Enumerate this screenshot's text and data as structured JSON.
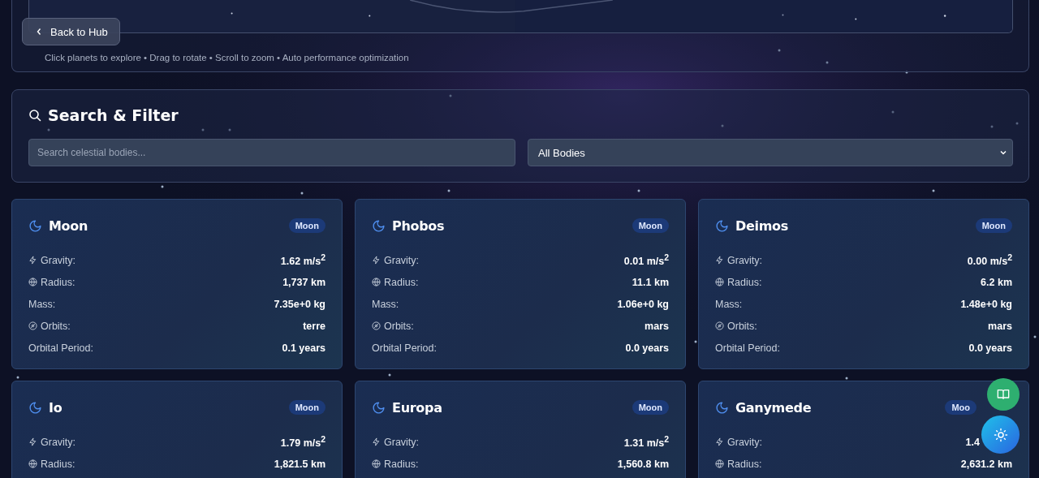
{
  "back_button": {
    "label": "Back to Hub"
  },
  "viewer": {
    "kind": "picture",
    "hint": "Click planets to explore • Drag to rotate • Scroll to zoom • Auto performance optimization"
  },
  "search_filter": {
    "title": "Search & Filter",
    "search": {
      "placeholder": "Search celestial bodies..."
    },
    "filter": {
      "value": "All Bodies"
    }
  },
  "cards": [
    {
      "name": "Moon",
      "badge": "Moon",
      "stats": [
        {
          "kind": "gravity",
          "label": "Gravity:",
          "value": "1.62 m/s$^{2}$"
        },
        {
          "kind": "radius",
          "label": "Radius:",
          "value": "1,737 km"
        },
        {
          "kind": "plain",
          "label": "Mass:",
          "value": "7.35e+0 kg"
        },
        {
          "kind": "orbit",
          "label": "Orbits:",
          "value": "terre"
        },
        {
          "kind": "plain",
          "label": "Orbital Period:",
          "value": "0.1 years"
        }
      ]
    },
    {
      "name": "Phobos",
      "badge": "Moon",
      "stats": [
        {
          "kind": "gravity",
          "label": "Gravity:",
          "value": "0.01 m/s$^{2}$"
        },
        {
          "kind": "radius",
          "label": "Radius:",
          "value": "11.1 km"
        },
        {
          "kind": "plain",
          "label": "Mass:",
          "value": "1.06e+0 kg"
        },
        {
          "kind": "orbit",
          "label": "Orbits:",
          "value": "mars"
        },
        {
          "kind": "plain",
          "label": "Orbital Period:",
          "value": "0.0 years"
        }
      ]
    },
    {
      "name": "Deimos",
      "badge": "Moon",
      "stats": [
        {
          "kind": "gravity",
          "label": "Gravity:",
          "value": "0.00 m/s$^{2}$"
        },
        {
          "kind": "radius",
          "label": "Radius:",
          "value": "6.2 km"
        },
        {
          "kind": "plain",
          "label": "Mass:",
          "value": "1.48e+0 kg"
        },
        {
          "kind": "orbit",
          "label": "Orbits:",
          "value": "mars"
        },
        {
          "kind": "plain",
          "label": "Orbital Period:",
          "value": "0.0 years"
        }
      ]
    },
    {
      "name": "Io",
      "badge": "Moon",
      "stats": [
        {
          "kind": "gravity",
          "label": "Gravity:",
          "value": "1.79 m/s$^{2}$"
        },
        {
          "kind": "radius",
          "label": "Radius:",
          "value": "1,821.5 km"
        }
      ]
    },
    {
      "name": "Europa",
      "badge": "Moon",
      "stats": [
        {
          "kind": "gravity",
          "label": "Gravity:",
          "value": "1.31 m/s$^{2}$"
        },
        {
          "kind": "radius",
          "label": "Radius:",
          "value": "1,560.8 km"
        }
      ]
    },
    {
      "name": "Ganymede",
      "badge": "Moo",
      "under_buttons": true,
      "stats": [
        {
          "kind": "gravity",
          "label": "Gravity:",
          "value": "1.4"
        },
        {
          "kind": "radius",
          "label": "Radius:",
          "value": "2,631.2 km"
        }
      ]
    }
  ]
}
